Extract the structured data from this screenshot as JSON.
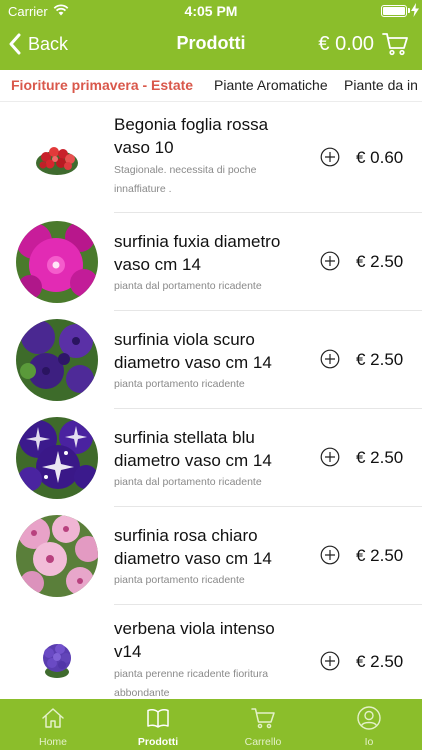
{
  "status": {
    "carrier": "Carrier",
    "time": "4:05 PM"
  },
  "nav": {
    "back_label": "Back",
    "title": "Prodotti",
    "cart_total": "€ 0.00"
  },
  "categories": [
    {
      "label": "Fioriture primavera - Estate",
      "active": true
    },
    {
      "label": "Piante Aromatiche",
      "active": false
    },
    {
      "label": "Piante da in",
      "active": false
    }
  ],
  "products": [
    {
      "name": "Begonia foglia rossa vaso 10",
      "description": "Stagionale. necessita di poche innaffiature .",
      "price": "€ 0.60",
      "image": "begonia-flowers"
    },
    {
      "name": "surfinia fuxia diametro vaso cm 14",
      "description": "pianta dal portamento ricadente",
      "price": "€ 2.50",
      "image": "fuchsia-petunia"
    },
    {
      "name": "surfinia viola scuro diametro vaso cm 14",
      "description": "pianta portamento ricadente",
      "price": "€ 2.50",
      "image": "dark-purple-petunia"
    },
    {
      "name": "surfinia stellata blu diametro vaso cm 14",
      "description": "pianta dal portamento ricadente",
      "price": "€ 2.50",
      "image": "starry-blue-petunia"
    },
    {
      "name": "surfinia rosa chiaro diametro vaso cm 14",
      "description": "pianta portamento ricadente",
      "price": "€ 2.50",
      "image": "light-pink-petunia"
    },
    {
      "name": "verbena viola intenso v14",
      "description": "pianta perenne ricadente fioritura abbondante",
      "price": "€ 2.50",
      "image": "purple-verbena"
    }
  ],
  "tabbar": [
    {
      "label": "Home",
      "icon": "home-icon",
      "active": false
    },
    {
      "label": "Prodotti",
      "icon": "book-icon",
      "active": true
    },
    {
      "label": "Carrello",
      "icon": "cart-icon",
      "active": false
    },
    {
      "label": "Io",
      "icon": "user-icon",
      "active": false
    }
  ],
  "colors": {
    "accent": "#8bbe2b",
    "active_category": "#d9584b"
  }
}
